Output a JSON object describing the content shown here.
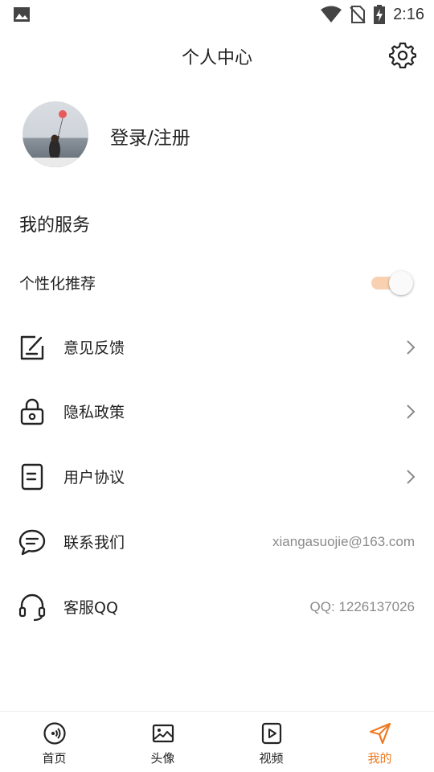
{
  "status_bar": {
    "time": "2:16"
  },
  "header": {
    "title": "个人中心"
  },
  "profile": {
    "login_label": "登录/注册"
  },
  "services": {
    "title": "我的服务",
    "personalized": {
      "label": "个性化推荐",
      "enabled": true
    },
    "items": [
      {
        "label": "意见反馈",
        "icon": "feedback-icon"
      },
      {
        "label": "隐私政策",
        "icon": "lock-icon"
      },
      {
        "label": "用户协议",
        "icon": "agreement-icon"
      },
      {
        "label": "联系我们",
        "icon": "chat-icon",
        "value": "xiangasuojie@163.com"
      },
      {
        "label": "客服QQ",
        "icon": "headset-icon",
        "value": "QQ: 1226137026"
      }
    ]
  },
  "bottom_nav": {
    "active_color": "#f07a22",
    "items": [
      {
        "label": "首页",
        "icon": "radio-icon"
      },
      {
        "label": "头像",
        "icon": "image-icon"
      },
      {
        "label": "视频",
        "icon": "play-icon"
      },
      {
        "label": "我的",
        "icon": "send-icon",
        "active": true
      }
    ]
  }
}
